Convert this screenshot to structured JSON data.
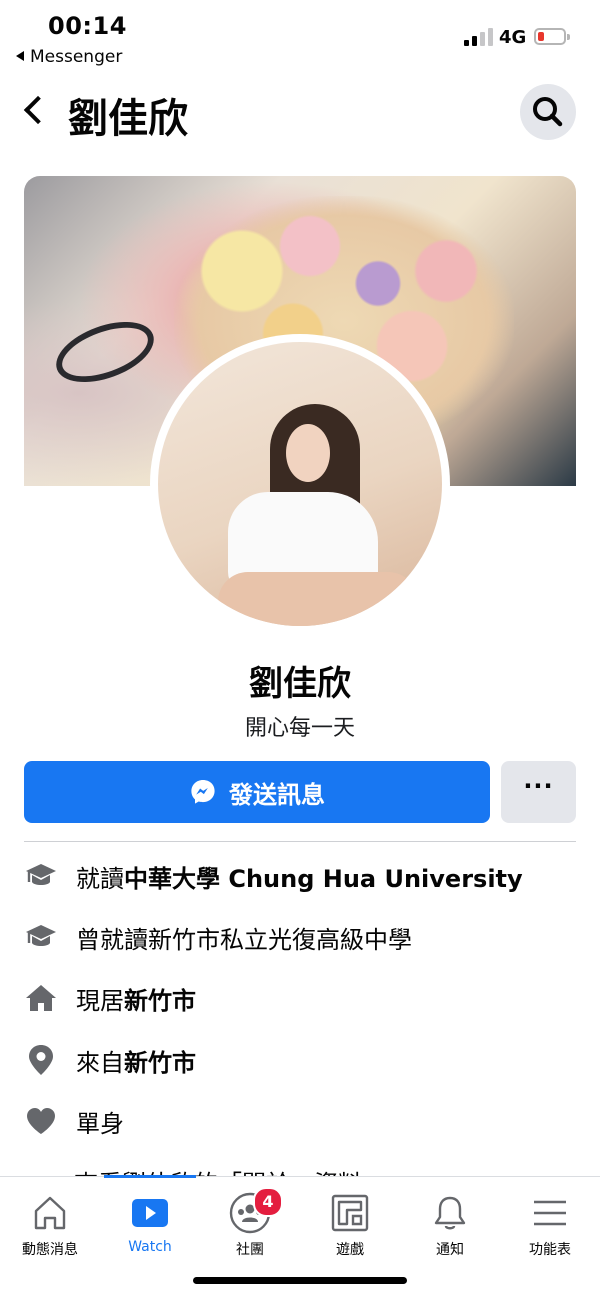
{
  "status_bar": {
    "time": "00:14",
    "back_app": "Messenger",
    "network": "4G",
    "battery_level": 0.15,
    "battery_color": "#e8372d"
  },
  "header": {
    "title": "劉佳欣",
    "back_icon": "chevron-left-icon",
    "search_icon": "search-icon"
  },
  "profile": {
    "name": "劉佳欣",
    "bio": "開心每一天",
    "message_button": "發送訊息",
    "more_button": "···"
  },
  "info": [
    {
      "icon": "graduation-cap-icon",
      "prefix": "就讀",
      "bold": "中華大學 Chung Hua University",
      "suffix": ""
    },
    {
      "icon": "graduation-cap-icon",
      "prefix": "曾就讀",
      "bold": "新竹市私立光復高級中學",
      "suffix": ""
    },
    {
      "icon": "home-icon",
      "prefix": "現居",
      "bold": "新竹市",
      "suffix": ""
    },
    {
      "icon": "location-pin-icon",
      "prefix": "來自",
      "bold": "新竹市",
      "suffix": ""
    },
    {
      "icon": "heart-icon",
      "prefix": "",
      "bold": "",
      "suffix": "單身"
    }
  ],
  "peek_text": "查看劉佳欣的「關於」資料",
  "tabbar": {
    "tabs": [
      {
        "label": "動態消息",
        "icon": "home-icon"
      },
      {
        "label": "Watch",
        "icon": "watch-video-icon"
      },
      {
        "label": "社團",
        "icon": "groups-icon",
        "badge": "4"
      },
      {
        "label": "遊戲",
        "icon": "gaming-icon"
      },
      {
        "label": "通知",
        "icon": "bell-icon"
      },
      {
        "label": "功能表",
        "icon": "menu-icon"
      }
    ]
  },
  "colors": {
    "accent": "#1877f2",
    "badge": "#e41e3f",
    "secondary_button": "#e4e6eb",
    "icon_gray": "#65676b"
  }
}
